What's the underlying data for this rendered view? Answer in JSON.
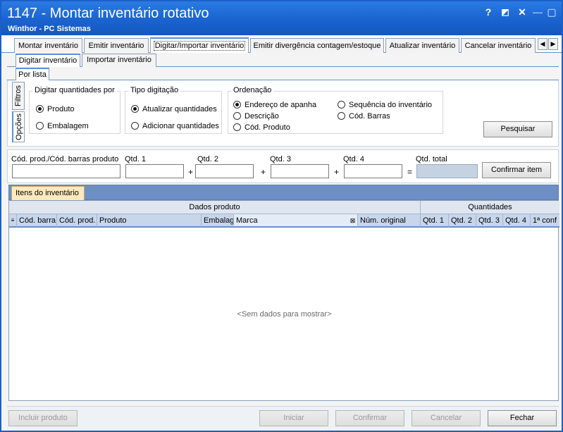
{
  "window": {
    "title": "1147 - Montar inventário rotativo",
    "subtitle": "Winthor - PC Sistemas",
    "controls": {
      "help": "?",
      "pin": "◩",
      "close": "✕",
      "minimize": "—",
      "maximize": "▢"
    }
  },
  "main_tabs": [
    "Montar inventário",
    "Emitir inventário",
    "Digitar/Importar inventário",
    "Emitir divergência contagem/estoque",
    "Atualizar inventário",
    "Cancelar inventário"
  ],
  "sub_tabs": [
    "Digitar inventário",
    "Importar inventário"
  ],
  "view_tab": "Por lista",
  "side_tabs": {
    "filters": "Filtros",
    "options": "Opções"
  },
  "options": {
    "digitar": {
      "legend": "Digitar quantidades por",
      "opt1": "Produto",
      "opt2": "Embalagem",
      "selected": "Produto"
    },
    "tipo": {
      "legend": "Tipo digitação",
      "opt1": "Atualizar quantidades",
      "opt2": "Adicionar quantidades",
      "selected": "Atualizar quantidades"
    },
    "ordenacao": {
      "legend": "Ordenação",
      "opt1": "Endereço de apanha",
      "opt2": "Descrição",
      "opt3": "Cód. Produto",
      "opt4": "Sequência do inventário",
      "opt5": "Cód. Barras",
      "selected": "Endereço de apanha"
    },
    "search_button": "Pesquisar"
  },
  "entry": {
    "cod_label": "Cód. prod./Cód. barras produto",
    "qtd1_label": "Qtd. 1",
    "qtd2_label": "Qtd. 2",
    "qtd3_label": "Qtd. 3",
    "qtd4_label": "Qtd. 4",
    "total_label": "Qtd. total",
    "plus": "+",
    "equals": "=",
    "confirm_button": "Confirmar item"
  },
  "grid": {
    "tab": "Itens do inventário",
    "band_produto": "Dados produto",
    "band_quantidades": "Quantidades",
    "columns": [
      "Cód. barra",
      "Cód. prod.",
      "Produto",
      "Embalag",
      "Marca",
      "Núm. original",
      "Qtd. 1",
      "Qtd. 2",
      "Qtd. 3",
      "Qtd. 4",
      "1ª conf"
    ],
    "empty_text": "<Sem dados para mostrar>"
  },
  "footer": {
    "include": "Incluir produto",
    "start": "Iniciar",
    "confirm": "Confirmar",
    "cancel": "Cancelar",
    "close": "Fechar"
  }
}
